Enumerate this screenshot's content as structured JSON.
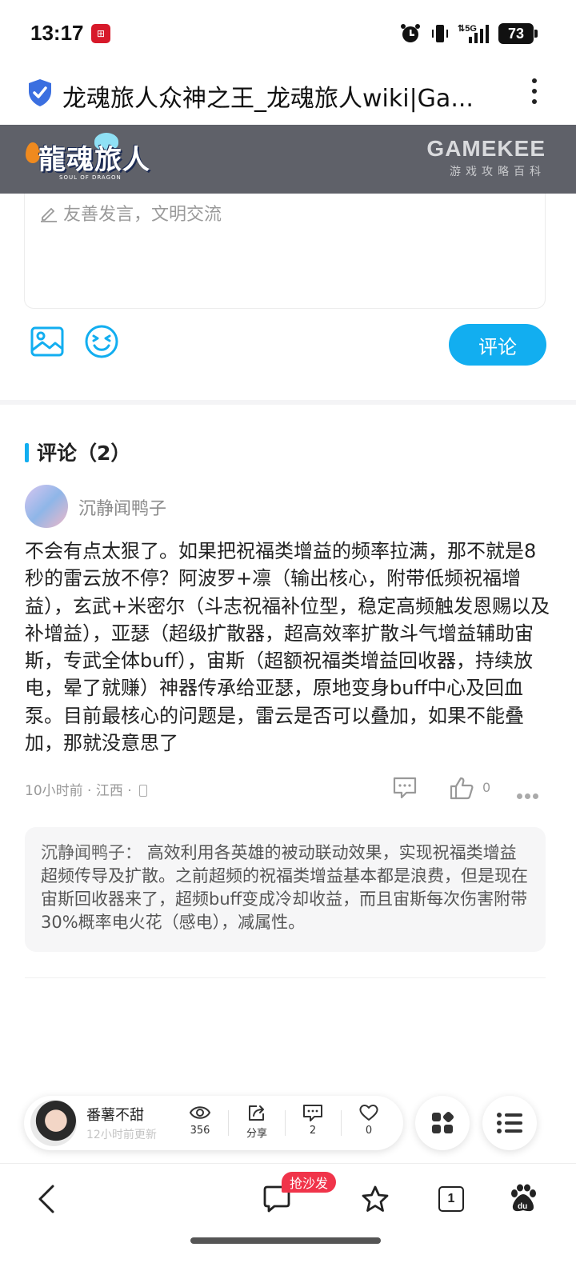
{
  "status_bar": {
    "time": "13:17",
    "app_badge": "⊞",
    "signal": "5G",
    "battery": "73"
  },
  "browser": {
    "page_title": "龙魂旅人众神之王_龙魂旅人wiki|Ga...",
    "secure_icon": "shield-check-icon",
    "menu_icon": "kebab-menu-icon"
  },
  "site_header": {
    "logo_text": "龍魂旅人",
    "logo_sub": "SOUL OF DRAGON",
    "brand": "GAMEKEE",
    "brand_sub": "游戏攻略百科"
  },
  "comment_form": {
    "placeholder": "友善发言，文明交流",
    "submit_label": "评论"
  },
  "comments": {
    "title": "评论（2）",
    "items": [
      {
        "author": "沉静闻鸭子",
        "body": "不会有点太狠了。如果把祝福类增益的频率拉满，那不就是8秒的雷云放不停？阿波罗+凛（输出核心，附带低频祝福增益），玄武+米密尔（斗志祝福补位型，稳定高频触发恩赐以及补增益），亚瑟（超级扩散器，超高效率扩散斗气增益辅助宙斯，专武全体buff），宙斯（超额祝福类增益回收器，持续放电，晕了就赚）神器传承给亚瑟，原地变身buff中心及回血泵。目前最核心的问题是，雷云是否可以叠加，如果不能叠加，那就没意思了",
        "time": "10小时前",
        "region": "江西",
        "likes": "0",
        "reply": {
          "author": "沉静闻鸭子：",
          "text": "高效利用各英雄的被动联动效果，实现祝福类增益超频传导及扩散。之前超频的祝福类增益基本都是浪费，但是现在宙斯回收器来了，超频buff变成冷却收益，而且宙斯每次伤害附带30%概率电火花（感电），减属性。"
        }
      }
    ]
  },
  "author_bar": {
    "name": "番薯不甜",
    "updated": "12小时前更新",
    "views": "356",
    "share_label": "分享",
    "comments": "2",
    "likes": "0"
  },
  "bottom_nav": {
    "sofa_badge": "抢沙发",
    "tab_count": "1"
  }
}
